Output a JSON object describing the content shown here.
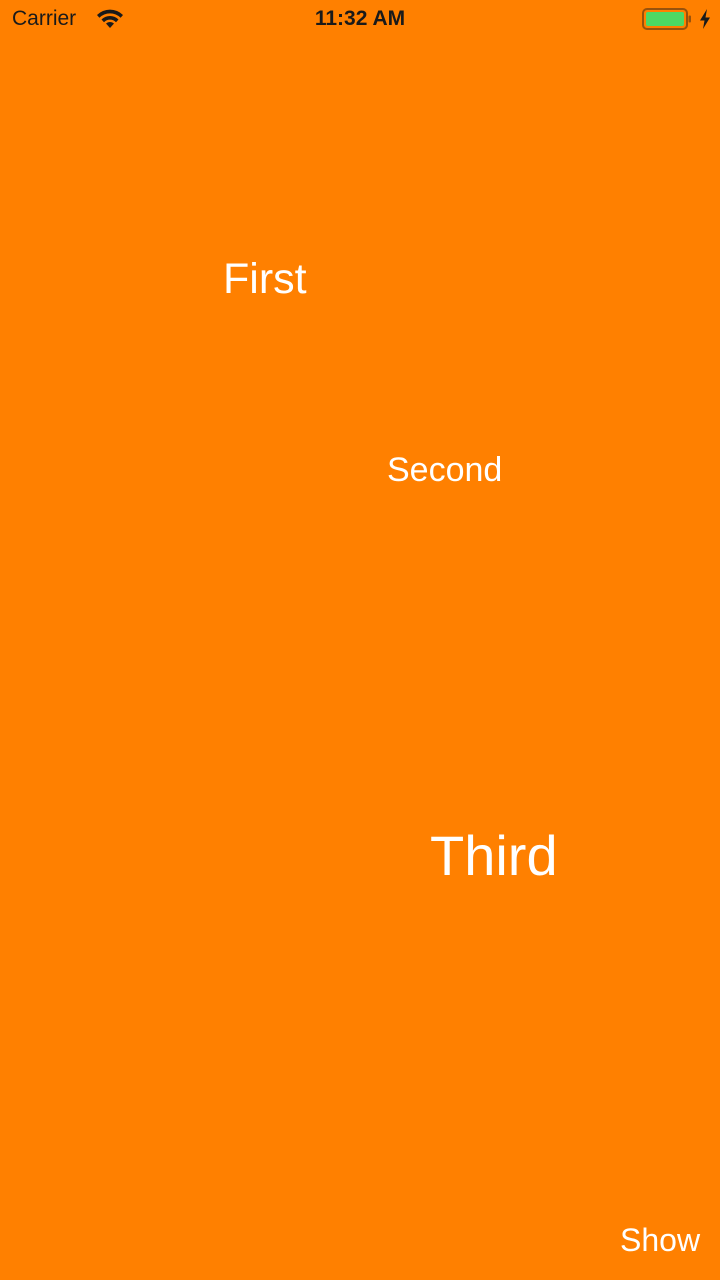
{
  "status_bar": {
    "carrier": "Carrier",
    "time": "11:32 AM",
    "icons": {
      "wifi": "wifi-icon",
      "battery": "battery-icon",
      "charging": "charging-bolt-icon"
    },
    "battery_color": "#4CD964"
  },
  "main": {
    "background_color": "#FF8000",
    "labels": {
      "first": "First",
      "second": "Second",
      "third": "Third"
    }
  },
  "footer": {
    "show_button_label": "Show"
  }
}
